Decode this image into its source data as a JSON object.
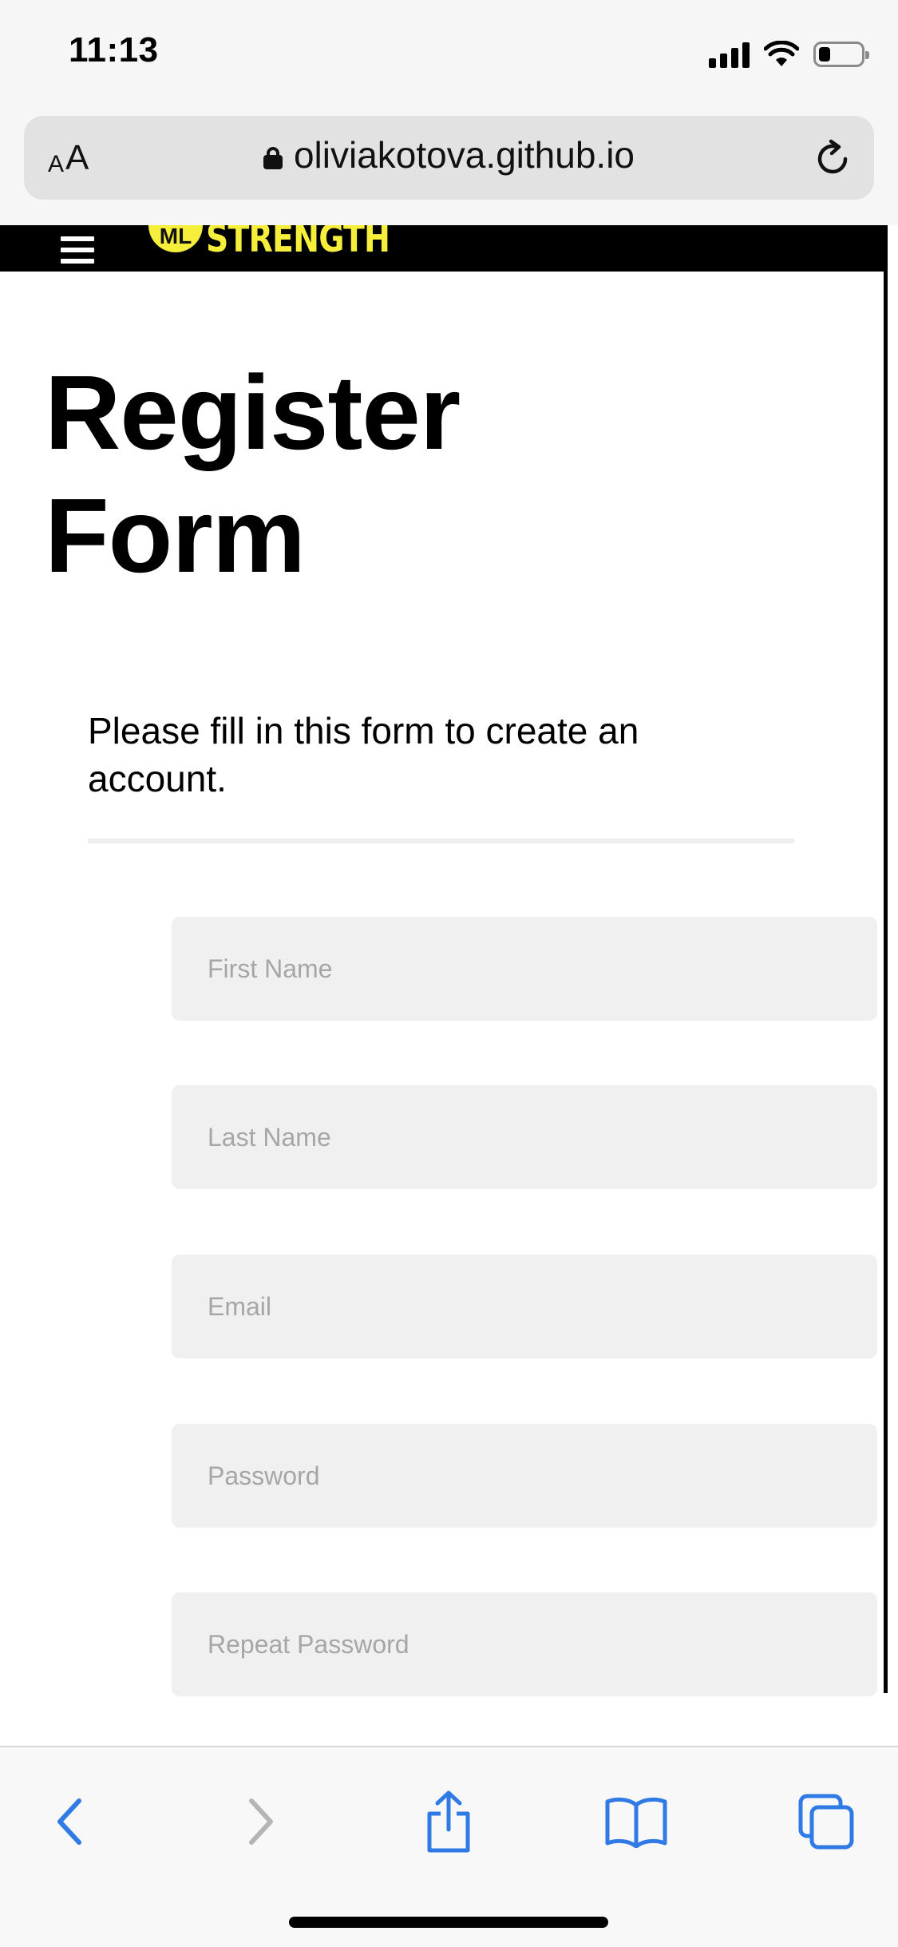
{
  "status_bar": {
    "time": "11:13"
  },
  "browser": {
    "aa_small": "A",
    "aa_big": "A",
    "domain": "oliviakotova.github.io"
  },
  "site": {
    "logo_badge": "ML",
    "logo_text": "STRENGTH"
  },
  "main": {
    "title_line1": "Register",
    "title_line2": "Form",
    "intro": "Please fill in this form to create an account."
  },
  "form": {
    "first_name_placeholder": "First Name",
    "last_name_placeholder": "Last Name",
    "email_placeholder": "Email",
    "password_placeholder": "Password",
    "repeat_password_placeholder": "Repeat Password"
  },
  "colors": {
    "accent_blue": "#2f7ae5",
    "disabled_gray": "#b5b5b5",
    "logo_yellow": "#f5ee3a",
    "field_bg": "#f0f0f0"
  }
}
